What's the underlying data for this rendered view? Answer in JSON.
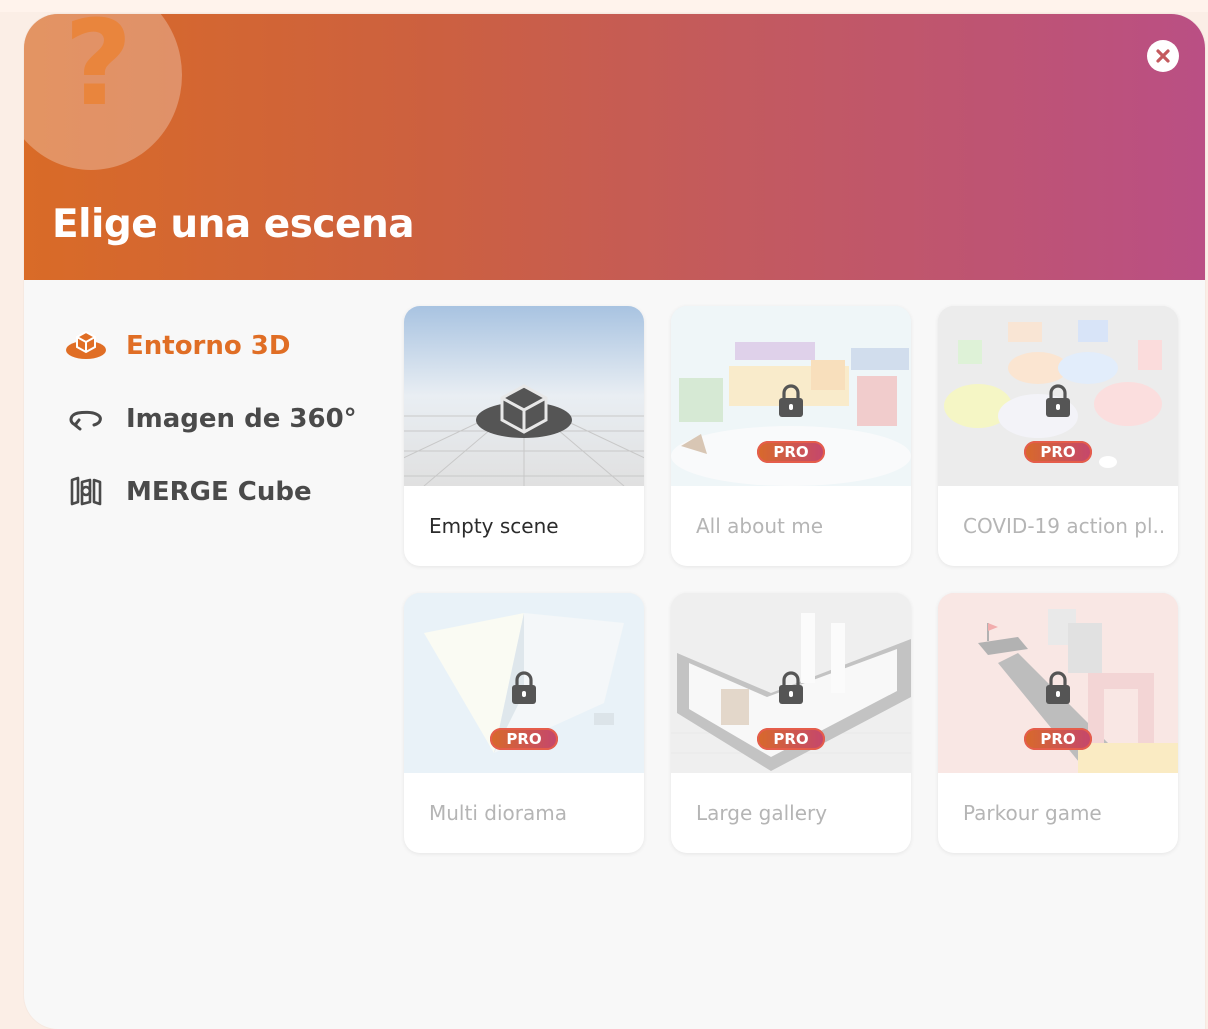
{
  "dialog": {
    "title": "Elige una escena",
    "help_glyph": "?"
  },
  "sidebar": {
    "items": [
      {
        "label": "Entorno 3D",
        "icon": "3d-environment-icon",
        "active": true
      },
      {
        "label": "Imagen de 360°",
        "icon": "360-rotate-icon",
        "active": false
      },
      {
        "label": "MERGE Cube",
        "icon": "merge-cube-icon",
        "active": false
      }
    ]
  },
  "scenes": [
    {
      "name": "Empty scene",
      "locked": false
    },
    {
      "name": "All about me",
      "locked": true,
      "badge": "PRO"
    },
    {
      "name": "COVID-19 action pl...",
      "locked": true,
      "badge": "PRO"
    },
    {
      "name": "Multi diorama",
      "locked": true,
      "badge": "PRO"
    },
    {
      "name": "Large gallery",
      "locked": true,
      "badge": "PRO"
    },
    {
      "name": "Parkour game",
      "locked": true,
      "badge": "PRO"
    }
  ],
  "colors": {
    "accent": "#e06e25",
    "header_gradient_start": "#d96b27",
    "header_gradient_end": "#ba4f84",
    "pro_badge": "#d86a2a"
  }
}
